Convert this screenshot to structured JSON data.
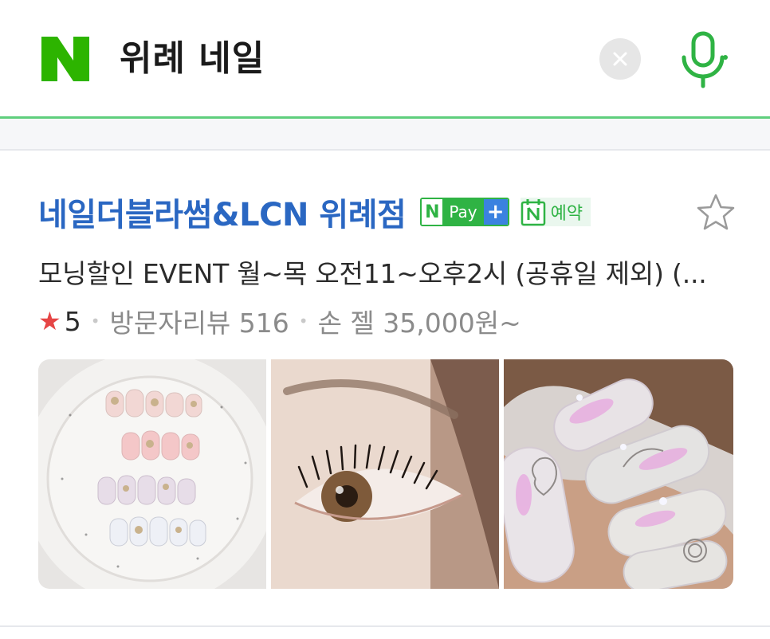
{
  "search": {
    "logo_letter": "N",
    "query": "위례 네일",
    "clear_icon": "close-icon",
    "mic_icon": "microphone-icon"
  },
  "place": {
    "name": "네일더블라썸&LCN 위례점",
    "npay": {
      "n": "N",
      "label": "Pay",
      "plus": "+"
    },
    "reservation": {
      "n": "N",
      "label": "예약"
    },
    "description": "모닝할인 EVENT 월~목 오전11~오후2시 (공휴일 제외) (...",
    "rating": {
      "star": "★",
      "value": "5"
    },
    "visitor_review": "방문자리뷰 516",
    "price": "손 젤 35,000원~",
    "photos": [
      {
        "subject": "nail tips on white plate"
      },
      {
        "subject": "eyelash close-up"
      },
      {
        "subject": "decorated pink nails"
      }
    ]
  },
  "colors": {
    "naver_green": "#2fb344",
    "title_blue": "#2a67c2",
    "rating_red": "#e64545"
  }
}
